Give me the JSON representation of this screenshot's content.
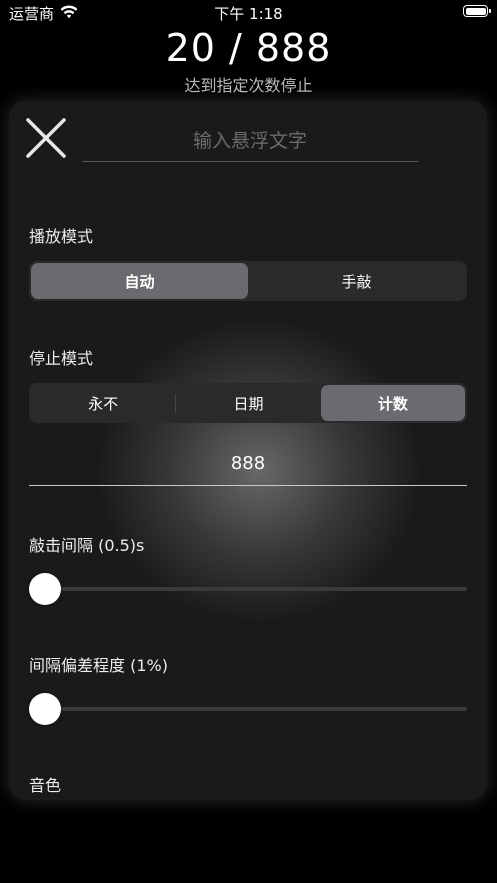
{
  "status_bar": {
    "carrier": "运营商",
    "time": "下午 1:18",
    "wifi_icon": "wifi-icon",
    "battery_icon": "battery-icon",
    "battery_level": 1.0
  },
  "counter": {
    "text": "20 / 888",
    "current": 20,
    "target": 888,
    "subtitle": "达到指定次数停止"
  },
  "panel": {
    "close_icon": "close-icon",
    "float_text_placeholder": "输入悬浮文字",
    "float_text_value": "",
    "play_mode": {
      "label": "播放模式",
      "options": [
        "自动",
        "手敲"
      ],
      "selected": 0
    },
    "stop_mode": {
      "label": "停止模式",
      "options": [
        "永不",
        "日期",
        "计数"
      ],
      "selected": 2
    },
    "count_value": "888",
    "tap_interval": {
      "label": "敲击间隔 (0.5)s",
      "value_fraction": 0.0
    },
    "interval_deviation": {
      "label": "间隔偏差程度 (1%)",
      "value_fraction": 0.0
    },
    "tone_label": "音色"
  },
  "colors": {
    "background": "#000000",
    "panel": "#1a1a1a",
    "segment_bg": "#2a2a2c",
    "segment_selected": "#6b6b6f",
    "slider_track": "#3a3a3c"
  }
}
